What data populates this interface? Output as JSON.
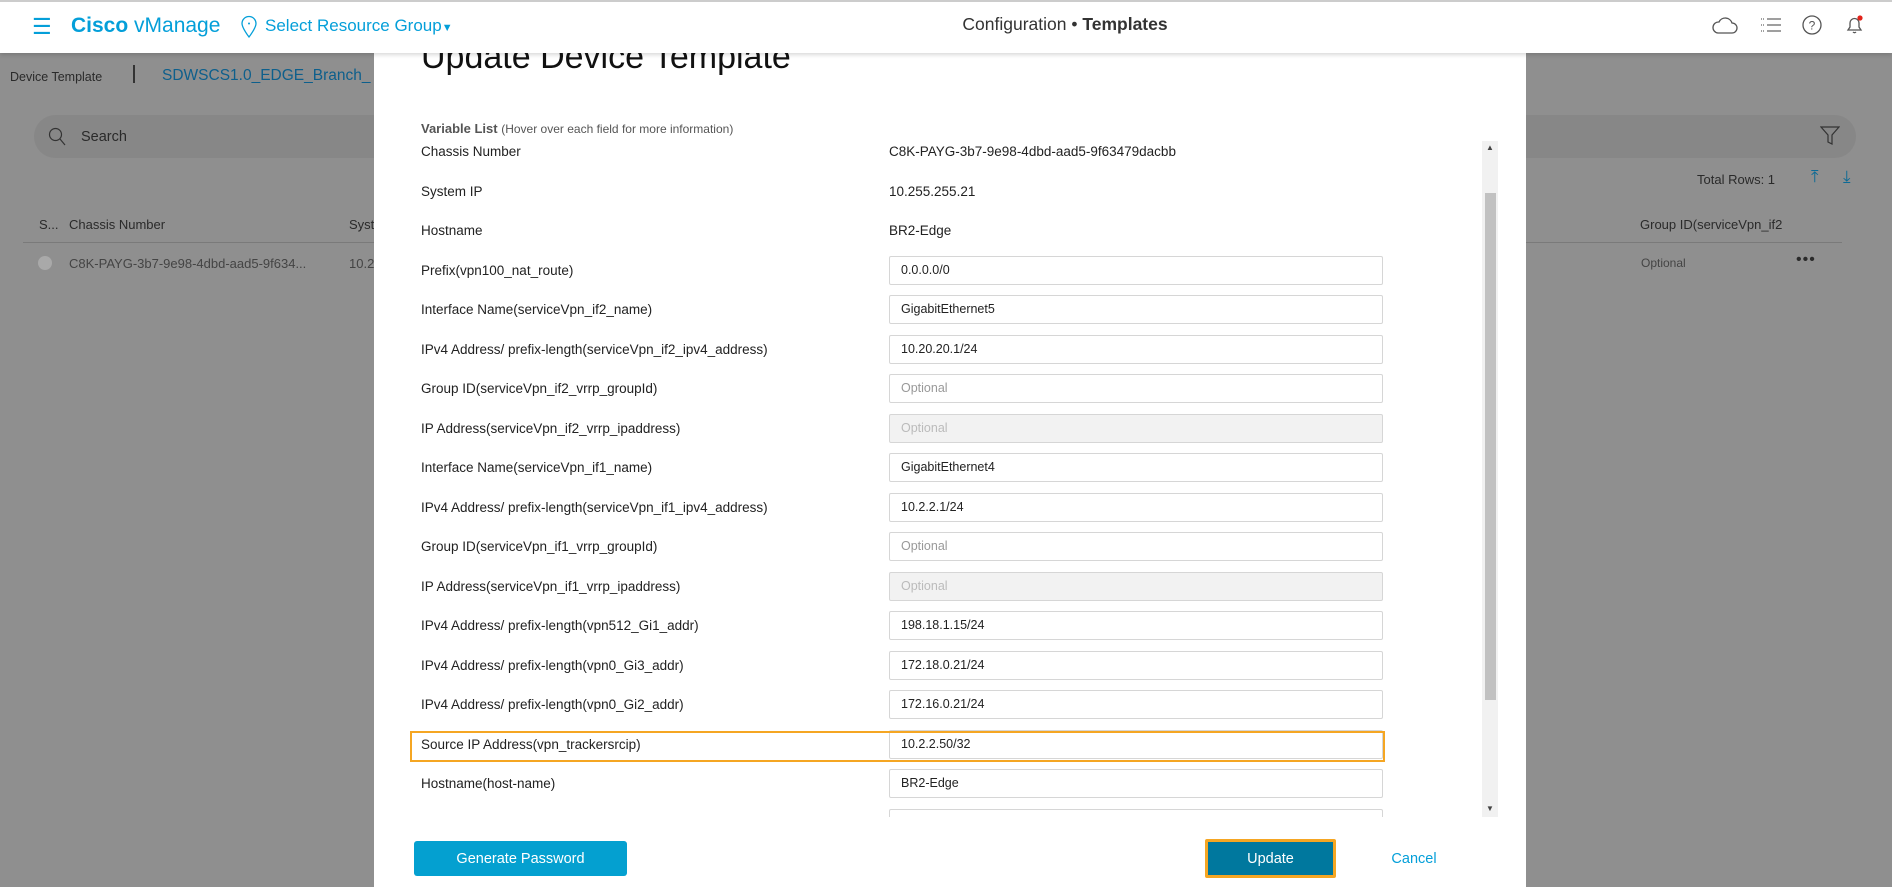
{
  "header": {
    "app_brand": "Cisco",
    "app_name": "vManage",
    "resource_group": "Select Resource Group",
    "page_section": "Configuration",
    "page_title": "Templates",
    "icons": [
      "menu-icon",
      "location-pin-icon",
      "cloud-icon",
      "task-list-icon",
      "help-icon",
      "bell-icon"
    ]
  },
  "background": {
    "breadcrumb": {
      "root": "Device Template",
      "current": "SDWSCS1.0_EDGE_Branch_"
    },
    "search_placeholder": "Search",
    "total_rows": "Total Rows: 1",
    "columns": [
      "S...",
      "Chassis Number",
      "Syst",
      "Group ID(serviceVpn_if2"
    ],
    "row": {
      "chassis": "C8K-PAYG-3b7-9e98-4dbd-aad5-9f634...",
      "system_ip": "10.2",
      "group_id": "Optional"
    }
  },
  "modal": {
    "title": "Update Device Template",
    "variable_list_label": "Variable List",
    "variable_list_hint": "(Hover over each field for more information)",
    "fields": [
      {
        "label": "Chassis Number",
        "value": "C8K-PAYG-3b7-9e98-4dbd-aad5-9f63479dacbb",
        "type": "text"
      },
      {
        "label": "System IP",
        "value": "10.255.255.21",
        "type": "text"
      },
      {
        "label": "Hostname",
        "value": "BR2-Edge",
        "type": "text"
      },
      {
        "label": "Prefix(vpn100_nat_route)",
        "value": "0.0.0.0/0",
        "type": "input"
      },
      {
        "label": "Interface Name(serviceVpn_if2_name)",
        "value": "GigabitEthernet5",
        "type": "input"
      },
      {
        "label": "IPv4 Address/ prefix-length(serviceVpn_if2_ipv4_address)",
        "value": "10.20.20.1/24",
        "type": "input"
      },
      {
        "label": "Group ID(serviceVpn_if2_vrrp_groupId)",
        "value": "Optional",
        "type": "placeholder"
      },
      {
        "label": "IP Address(serviceVpn_if2_vrrp_ipaddress)",
        "value": "Optional",
        "type": "disabled"
      },
      {
        "label": "Interface Name(serviceVpn_if1_name)",
        "value": "GigabitEthernet4",
        "type": "input"
      },
      {
        "label": "IPv4 Address/ prefix-length(serviceVpn_if1_ipv4_address)",
        "value": "10.2.2.1/24",
        "type": "input"
      },
      {
        "label": "Group ID(serviceVpn_if1_vrrp_groupId)",
        "value": "Optional",
        "type": "placeholder"
      },
      {
        "label": "IP Address(serviceVpn_if1_vrrp_ipaddress)",
        "value": "Optional",
        "type": "disabled"
      },
      {
        "label": "IPv4 Address/ prefix-length(vpn512_Gi1_addr)",
        "value": "198.18.1.15/24",
        "type": "input"
      },
      {
        "label": "IPv4 Address/ prefix-length(vpn0_Gi3_addr)",
        "value": "172.18.0.21/24",
        "type": "input"
      },
      {
        "label": "IPv4 Address/ prefix-length(vpn0_Gi2_addr)",
        "value": "172.16.0.21/24",
        "type": "input"
      },
      {
        "label": "Source IP Address(vpn_trackersrcip)",
        "value": "10.2.2.50/32",
        "type": "input",
        "highlighted": true
      },
      {
        "label": "Hostname(host-name)",
        "value": "BR2-Edge",
        "type": "input"
      },
      {
        "label": "",
        "value": "",
        "type": "input"
      }
    ],
    "buttons": {
      "generate_password": "Generate Password",
      "update": "Update",
      "cancel": "Cancel"
    }
  },
  "colors": {
    "brand": "#049fd9",
    "highlight": "#f5a623",
    "update_button": "#00789e",
    "generate_button": "#04a0d0"
  }
}
